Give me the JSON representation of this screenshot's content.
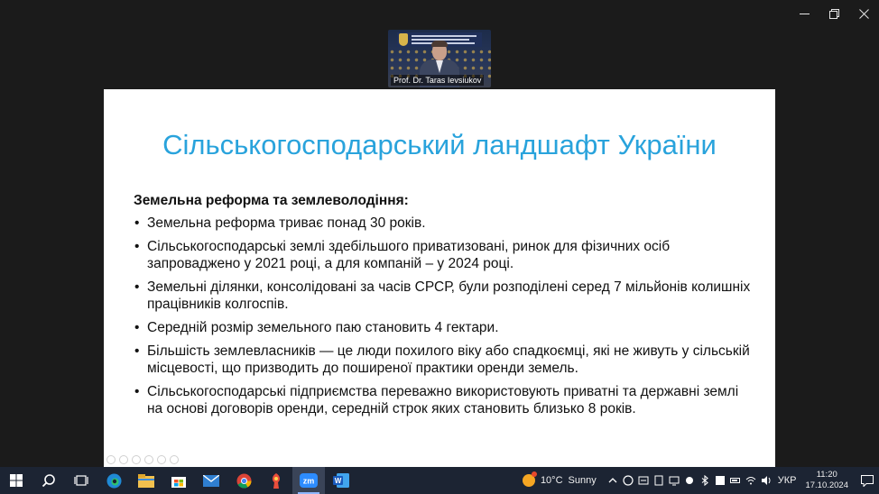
{
  "window": {
    "controls": [
      "minimize-icon",
      "restore-icon",
      "close-icon"
    ]
  },
  "video": {
    "participant_name": "Prof. Dr. Taras Ievsiukov"
  },
  "slide": {
    "title": "Сільськогосподарський ландшафт України",
    "subtitle": "Земельна реформа та землеволодіння:",
    "bullets": [
      "Земельна реформа триває понад 30 років.",
      "Сільськогосподарські землі здебільшого приватизовані, ринок для фізичних осіб запроваджено у 2021 році, а для компаній – у 2024 році.",
      "Земельні ділянки, консолідовані за часів СРСР, були розподілені серед 7 мільйонів колишніх працівників колгоспів.",
      "Середній розмір земельного паю становить 4 гектари.",
      "Більшість землевласників — це люди похилого віку або спадкоємці, які не живуть у сільській місцевості, що призводить до поширеної практики оренди земель.",
      "Сільськогосподарські підприємства переважно використовують приватні та державні землі на основі договорів оренди, середній строк яких становить близько 8 років."
    ],
    "title_color": "#29a3dc"
  },
  "taskbar": {
    "apps": [
      "windows-start-icon",
      "search-icon",
      "task-view-icon",
      "edge-icon",
      "file-explorer-icon",
      "store-icon",
      "mail-icon",
      "chrome-icon",
      "app-icon",
      "zoom-icon",
      "word-icon"
    ],
    "active_app": "zoom-icon",
    "zoom_label": "zm",
    "word_label": "W",
    "weather_temp": "10°C",
    "weather_text": "Sunny",
    "language": "УКР",
    "time": "11:20",
    "date": "17.10.2024"
  }
}
